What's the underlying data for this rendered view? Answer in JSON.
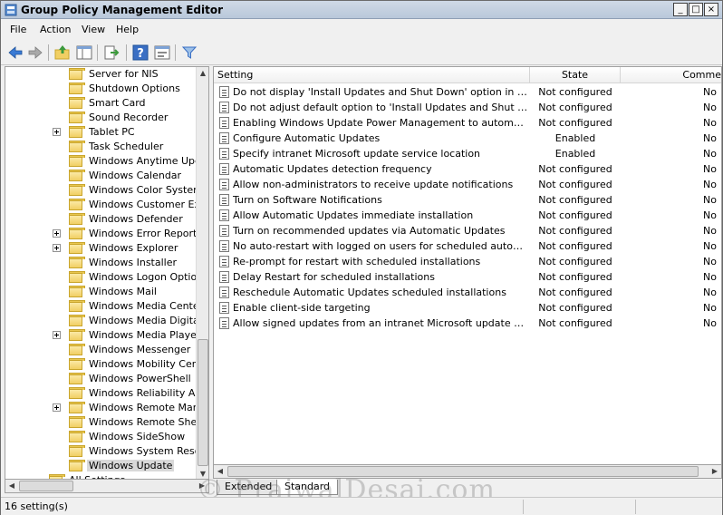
{
  "window": {
    "title": "Group Policy Management Editor"
  },
  "menu": [
    "File",
    "Action",
    "View",
    "Help"
  ],
  "toolbar": [
    "back-icon",
    "forward-icon",
    "up-folder-icon",
    "show-hide-tree-icon",
    "export-list-icon",
    "help-icon",
    "properties-icon",
    "filter-icon"
  ],
  "tree": {
    "items": [
      {
        "label": "Server for NIS",
        "expandable": false
      },
      {
        "label": "Shutdown Options",
        "expandable": false
      },
      {
        "label": "Smart Card",
        "expandable": false
      },
      {
        "label": "Sound Recorder",
        "expandable": false
      },
      {
        "label": "Tablet PC",
        "expandable": true
      },
      {
        "label": "Task Scheduler",
        "expandable": false
      },
      {
        "label": "Windows Anytime Upgrade",
        "expandable": false
      },
      {
        "label": "Windows Calendar",
        "expandable": false
      },
      {
        "label": "Windows Color System",
        "expandable": false
      },
      {
        "label": "Windows Customer Experience",
        "expandable": false
      },
      {
        "label": "Windows Defender",
        "expandable": false
      },
      {
        "label": "Windows Error Reporting",
        "expandable": true
      },
      {
        "label": "Windows Explorer",
        "expandable": true
      },
      {
        "label": "Windows Installer",
        "expandable": false
      },
      {
        "label": "Windows Logon Options",
        "expandable": false
      },
      {
        "label": "Windows Mail",
        "expandable": false
      },
      {
        "label": "Windows Media Center",
        "expandable": false
      },
      {
        "label": "Windows Media Digital Rights",
        "expandable": false
      },
      {
        "label": "Windows Media Player",
        "expandable": true
      },
      {
        "label": "Windows Messenger",
        "expandable": false
      },
      {
        "label": "Windows Mobility Center",
        "expandable": false
      },
      {
        "label": "Windows PowerShell",
        "expandable": false
      },
      {
        "label": "Windows Reliability Analysis",
        "expandable": false
      },
      {
        "label": "Windows Remote Management",
        "expandable": true
      },
      {
        "label": "Windows Remote Shell",
        "expandable": false
      },
      {
        "label": "Windows SideShow",
        "expandable": false
      },
      {
        "label": "Windows System Resource",
        "expandable": false
      },
      {
        "label": "Windows Update",
        "expandable": false,
        "selected": true
      }
    ],
    "partial_item": "All Settings"
  },
  "list": {
    "columns": [
      "Setting",
      "State",
      "Comme"
    ],
    "rows": [
      {
        "setting": "Do not display 'Install Updates and Shut Down' option in Shut Down Windows dialog box",
        "state": "Not configured",
        "comment": "No"
      },
      {
        "setting": "Do not adjust default option to 'Install Updates and Shut Down' in Shut Down Windows dialog box",
        "state": "Not configured",
        "comment": "No"
      },
      {
        "setting": "Enabling Windows Update Power Management to automatically wake up the system",
        "state": "Not configured",
        "comment": "No"
      },
      {
        "setting": "Configure Automatic Updates",
        "state": "Enabled",
        "comment": "No"
      },
      {
        "setting": "Specify intranet Microsoft update service location",
        "state": "Enabled",
        "comment": "No"
      },
      {
        "setting": "Automatic Updates detection frequency",
        "state": "Not configured",
        "comment": "No"
      },
      {
        "setting": "Allow non-administrators to receive update notifications",
        "state": "Not configured",
        "comment": "No"
      },
      {
        "setting": "Turn on Software Notifications",
        "state": "Not configured",
        "comment": "No"
      },
      {
        "setting": "Allow Automatic Updates immediate installation",
        "state": "Not configured",
        "comment": "No"
      },
      {
        "setting": "Turn on recommended updates via Automatic Updates",
        "state": "Not configured",
        "comment": "No"
      },
      {
        "setting": "No auto-restart with logged on users for scheduled automatic updates installations",
        "state": "Not configured",
        "comment": "No"
      },
      {
        "setting": "Re-prompt for restart with scheduled installations",
        "state": "Not configured",
        "comment": "No"
      },
      {
        "setting": "Delay Restart for scheduled installations",
        "state": "Not configured",
        "comment": "No"
      },
      {
        "setting": "Reschedule Automatic Updates scheduled installations",
        "state": "Not configured",
        "comment": "No"
      },
      {
        "setting": "Enable client-side targeting",
        "state": "Not configured",
        "comment": "No"
      },
      {
        "setting": "Allow signed updates from an intranet Microsoft update service location",
        "state": "Not configured",
        "comment": "No"
      }
    ]
  },
  "tabs": [
    {
      "label": "Extended",
      "active": false
    },
    {
      "label": "Standard",
      "active": true
    }
  ],
  "status": {
    "text": "16 setting(s)"
  },
  "watermark": "© PrajwalDesai.com"
}
